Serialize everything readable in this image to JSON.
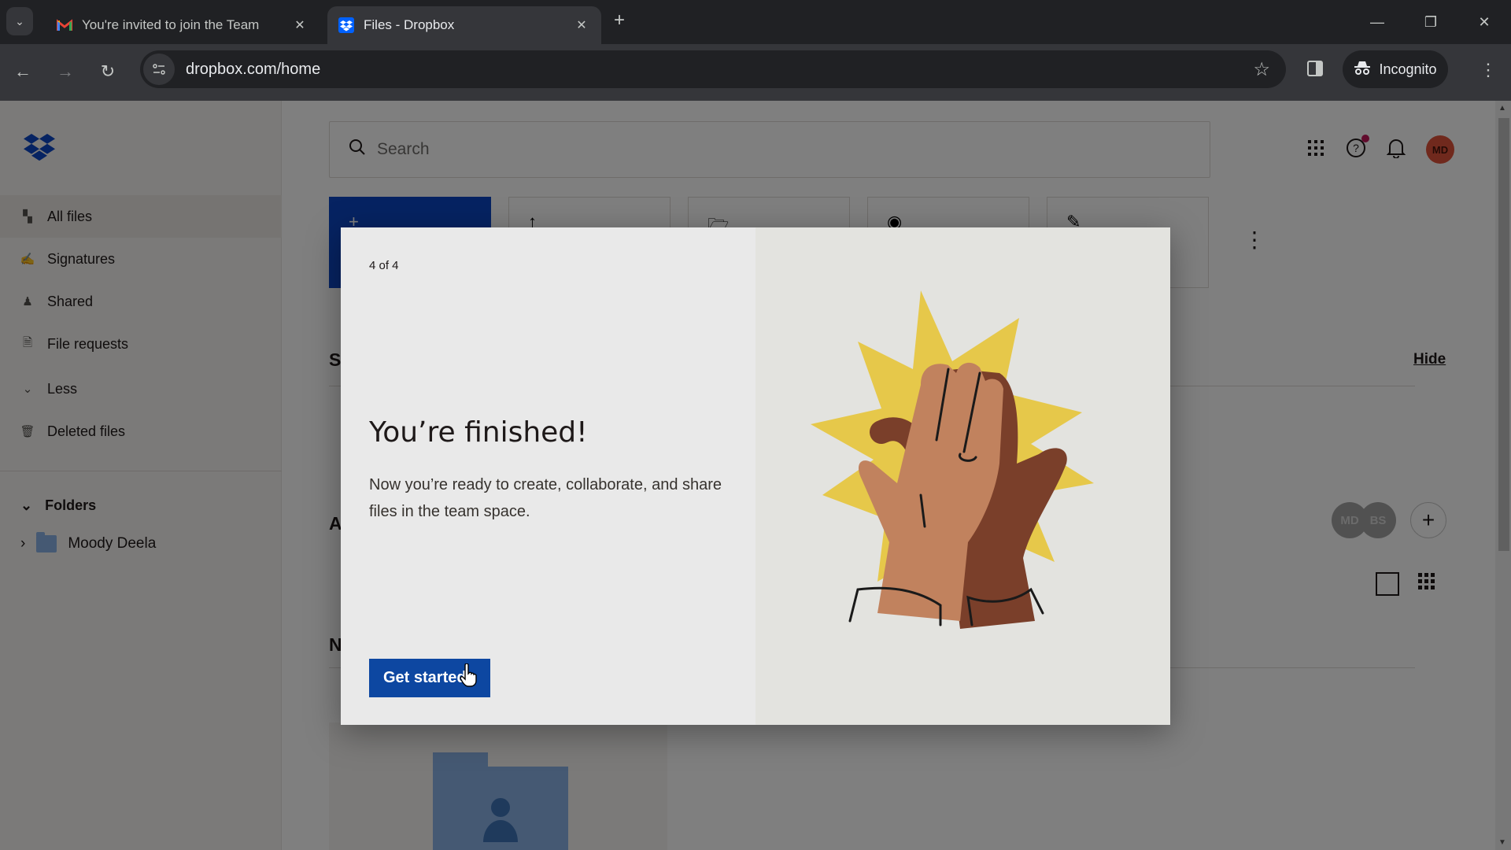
{
  "browser": {
    "tabs": [
      {
        "title": "You're invited to join the Team",
        "favicon": "gmail-icon",
        "active": false
      },
      {
        "title": "Files - Dropbox",
        "favicon": "dropbox-icon",
        "active": true
      }
    ],
    "new_tab_label": "+",
    "url": "dropbox.com/home",
    "incognito_label": "Incognito",
    "window_controls": [
      "minimize",
      "restore",
      "close"
    ]
  },
  "sidebar": {
    "items": [
      {
        "label": "All files",
        "icon": "all-files-icon",
        "active": true
      },
      {
        "label": "Signatures",
        "icon": "signature-icon",
        "active": false
      },
      {
        "label": "Shared",
        "icon": "shared-icon",
        "active": false
      },
      {
        "label": "File requests",
        "icon": "file-request-icon",
        "active": false
      },
      {
        "label": "Less",
        "icon": "chevron-down-icon",
        "active": false
      },
      {
        "label": "Deleted files",
        "icon": "trash-icon",
        "active": false
      }
    ],
    "folders_header": "Folders",
    "folders": [
      {
        "name": "Moody Deela"
      }
    ]
  },
  "main": {
    "search_placeholder": "Search",
    "header_icons": [
      "apps-grid-icon",
      "help-icon",
      "bell-icon"
    ],
    "user_initials": "MD",
    "accent_color": "#0d47c4",
    "action_tiles": [
      {
        "icon": "plus-icon",
        "primary": true
      },
      {
        "icon": "upload-icon",
        "primary": false
      },
      {
        "icon": "folder-plus-icon",
        "primary": false
      },
      {
        "icon": "record-icon",
        "primary": false
      },
      {
        "icon": "pencil-icon",
        "primary": false
      }
    ],
    "section_letters": [
      "S",
      "A",
      "N"
    ],
    "hide_label": "Hide",
    "members": [
      "MD",
      "BS"
    ],
    "add_member_label": "+"
  },
  "modal": {
    "step": "4 of 4",
    "title": "You’re finished!",
    "body": "Now you’re ready to create, collaborate, and share files in the team space.",
    "cta_label": "Get started",
    "illustration": "high-five-illustration"
  }
}
